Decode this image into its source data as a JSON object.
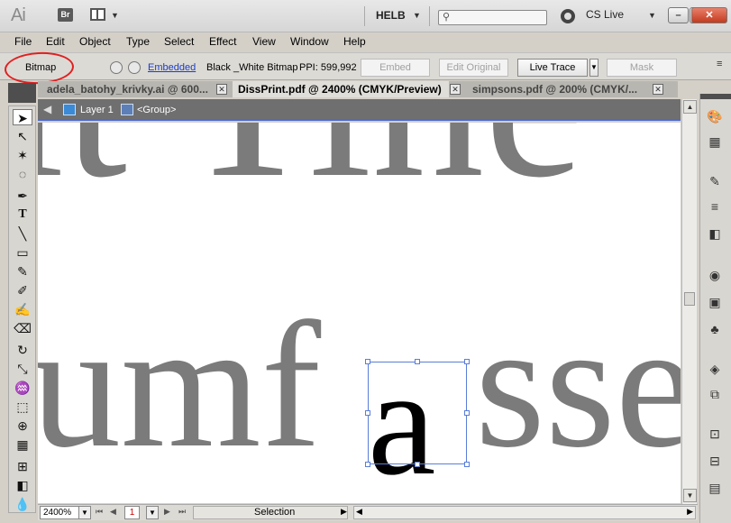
{
  "app": {
    "logo": "Ai",
    "bridge": "Br",
    "workspace": "HELB",
    "cs_live": "CS Live",
    "win_min": "–",
    "win_max": "□",
    "win_close": "✕"
  },
  "menu": {
    "items": [
      "File",
      "Edit",
      "Object",
      "Type",
      "Select",
      "Effect",
      "View",
      "Window",
      "Help"
    ]
  },
  "control": {
    "object_type": "Bitmap",
    "embedded": "Embedded",
    "color_mode": "Black _White Bitmap",
    "ppi": "PPI: 599,992",
    "embed_label": "Embed",
    "edit_original_label": "Edit Original",
    "live_trace_label": "Live Trace",
    "mask_label": "Mask"
  },
  "tabs": [
    {
      "label": "adela_batohy_krivky.ai @ 600...",
      "close": "✕"
    },
    {
      "label": "DissPrint.pdf @ 2400% (CMYK/Preview)",
      "close": "✕"
    },
    {
      "label": "simpsons.pdf @ 200% (CMYK/...",
      "close": "✕"
    }
  ],
  "breadcrumb": {
    "layer": "Layer 1",
    "group": "<Group>"
  },
  "canvas": {
    "top_text": "it Tine",
    "bottom_text": "umf",
    "black_letter": "a",
    "trail_text": "sse"
  },
  "status": {
    "zoom": "2400%",
    "page": "1",
    "mode": "Selection"
  },
  "colors": {
    "accent_oval": "#e02020",
    "selection": "#5a7ed8",
    "text_gray": "#7b7b7b"
  }
}
